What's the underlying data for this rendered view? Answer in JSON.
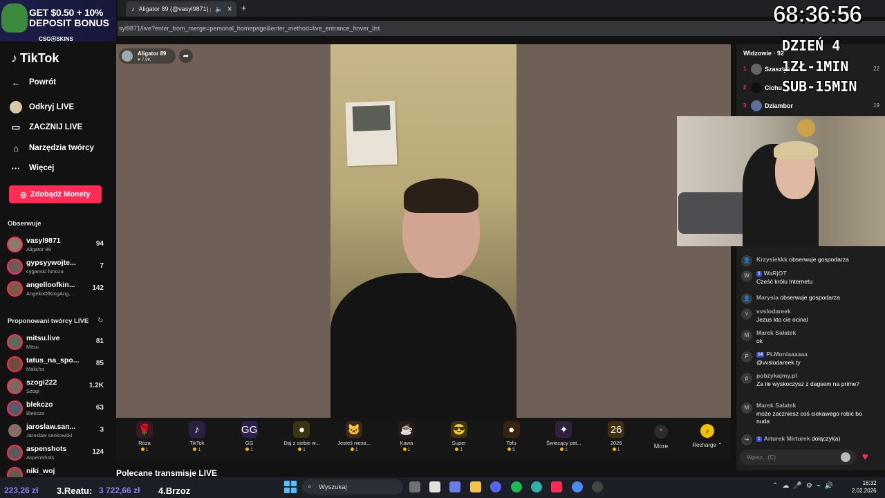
{
  "ad": {
    "line1": "GET $0.50 + 10%",
    "line2": "DEPOSIT BONUS",
    "brand": "CSG⦿SKINS"
  },
  "browser": {
    "tab_title": "Aligator 89 (@vasyl9871) p",
    "url": "syl9871/live?enter_from_merge=personal_homepage&enter_method=live_entrance_hover_list"
  },
  "sidebar": {
    "logo": "TikTok",
    "back": "Powrót",
    "nav": [
      {
        "label": "Odkryj LIVE",
        "icon": "live-discover-icon"
      },
      {
        "label": "ZACZNIJ LIVE",
        "icon": "camera-icon"
      },
      {
        "label": "Narzędzia twórcy",
        "icon": "home-icon"
      },
      {
        "label": "Więcej",
        "icon": "more-icon"
      }
    ],
    "coins_button": "Zdobądź Monety",
    "following_title": "Obserwuje",
    "following": [
      {
        "name": "vasyl9871",
        "sub": "Aligator 89",
        "count": "94"
      },
      {
        "name": "gypsyywojte...",
        "sub": "cyganski furioza",
        "count": "7"
      },
      {
        "name": "angelloofkin...",
        "sub": "AngelloOfKingAng...",
        "count": "142"
      }
    ],
    "suggested_title": "Proponowani twórcy LIVE",
    "suggested": [
      {
        "name": "mitsu.live",
        "sub": "Mitsu",
        "count": "81"
      },
      {
        "name": "tatus_na_spo...",
        "sub": "Malicha",
        "count": "85"
      },
      {
        "name": "szogi222",
        "sub": "Szogi",
        "count": "1.2K"
      },
      {
        "name": "blekczo",
        "sub": "Blekczo",
        "count": "63"
      },
      {
        "name": "jaroslaw.san...",
        "sub": "Jaroslaw sankowski",
        "count": "3"
      },
      {
        "name": "aspenshots",
        "sub": "AspenShots",
        "count": "124"
      },
      {
        "name": "niki_woj",
        "sub": "",
        "count": ""
      }
    ]
  },
  "stream": {
    "host_name": "Aligator 89",
    "host_likes": "7.9K",
    "recommended_title": "Polecane transmisje LIVE"
  },
  "gifts": [
    {
      "name": "Róża",
      "price": "1",
      "icon": "🌹",
      "color": "#3a1a22"
    },
    {
      "name": "TikTok",
      "price": "1",
      "icon": "♪",
      "color": "#2a2040"
    },
    {
      "name": "GG",
      "price": "1",
      "icon": "GG",
      "color": "#2d2050"
    },
    {
      "name": "Daj z siebie w...",
      "price": "1",
      "icon": "●",
      "color": "#3a3410"
    },
    {
      "name": "Jesteś niesa...",
      "price": "1",
      "icon": "🐱",
      "color": "#3a2a1a"
    },
    {
      "name": "Kawa",
      "price": "1",
      "icon": "☕",
      "color": "#2a1a14"
    },
    {
      "name": "Super",
      "price": "1",
      "icon": "😎",
      "color": "#3a3410"
    },
    {
      "name": "Tofu",
      "price": "5",
      "icon": "●",
      "color": "#3a2410"
    },
    {
      "name": "Świecący pat...",
      "price": "1",
      "icon": "✦",
      "color": "#302040"
    },
    {
      "name": "2026",
      "price": "1",
      "icon": "26",
      "color": "#403010"
    }
  ],
  "gift_more": "More",
  "recharge": "Recharge",
  "viewers": {
    "title": "Widzowie · 92",
    "rows": [
      {
        "rank": "1",
        "name": "Szaszłyk",
        "count": "22"
      },
      {
        "rank": "2",
        "name": "Cichu",
        "count": ""
      },
      {
        "rank": "3",
        "name": "Dziambor",
        "count": "19"
      }
    ]
  },
  "chat": [
    {
      "user": "Krzysiekkk",
      "text": "obserwuje gospodarza",
      "inline": true,
      "avatar": "👤"
    },
    {
      "user": "WaRjOT",
      "badge": "1",
      "text": "Cześć królu Internetu",
      "avatar": "W"
    },
    {
      "user": "Marysia",
      "text": "obserwuje gospodarza",
      "inline": true,
      "avatar": "👤"
    },
    {
      "user": "vvslodareek",
      "text": "Jezus kto cie ocinal",
      "avatar": "v"
    },
    {
      "user": "Marek Sałatek",
      "text": "ok",
      "avatar": "M"
    },
    {
      "user": "PLMoniaaaaaa",
      "badge": "14",
      "text": "@vvslodareek ty",
      "avatar": "P"
    },
    {
      "user": "pobzykajmy.pl",
      "text": "Za ile wyskoczysz z dagsem na prime?",
      "avatar": "p"
    },
    {
      "user": "Marek Sałatek",
      "text": "może zaczniesz coś ciekawego robić bo nuda",
      "avatar": "M"
    },
    {
      "user": "Arturek Mirturek",
      "badge": "1",
      "text": "dołączył(a)",
      "inline": true,
      "avatar": "↪"
    }
  ],
  "chat_placeholder": "Wpisz...(C)",
  "overlay": {
    "timer": "68:36:56",
    "day": "DZIEŃ 4",
    "rate": "1ZŁ-1MIN",
    "sub": "SUB-15MIN",
    "money": "223,26 zł",
    "reatu_label": "3.Reatu:",
    "reatu_value": "3 722,66 zł",
    "brzoz": "4.Brzoz"
  },
  "taskbar": {
    "search_placeholder": "Wyszukaj",
    "time": "16:32",
    "date": "2.02.2026"
  },
  "colors": {
    "accent": "#fe2c55",
    "coin": "#f2c200",
    "donation": "#8e7cf0"
  }
}
